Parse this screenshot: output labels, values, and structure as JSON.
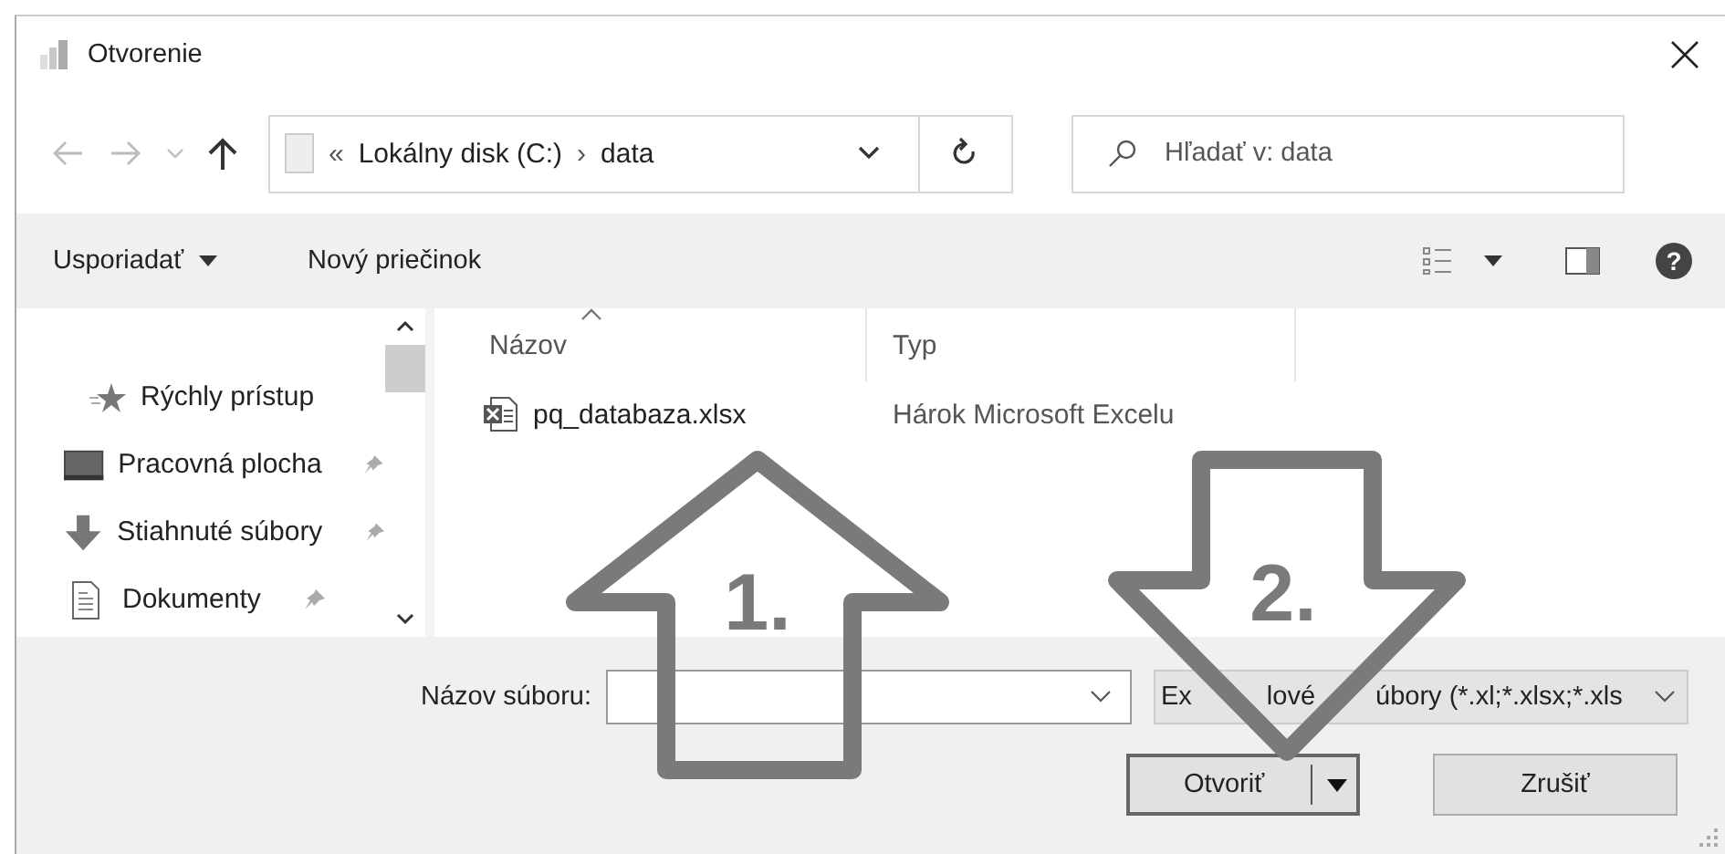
{
  "window": {
    "title": "Otvorenie"
  },
  "nav": {
    "back": {
      "disabled": true
    },
    "forward": {
      "disabled": true
    },
    "up": {
      "disabled": false
    },
    "path": [
      {
        "kind": "overflow",
        "text": "«"
      },
      {
        "kind": "segment",
        "text": "Lokálny disk (C:)"
      },
      {
        "kind": "separator",
        "text": "›"
      },
      {
        "kind": "segment",
        "text": "data"
      }
    ],
    "search": {
      "placeholder": "Hľadať v: data"
    }
  },
  "toolbar": {
    "organize": "Usporiadať",
    "new_folder": "Nový priečinok",
    "help": "?"
  },
  "sidebar": {
    "items": [
      {
        "kind": "quick_access",
        "label": "Rýchly prístup",
        "pinned": false
      },
      {
        "kind": "desktop",
        "label": "Pracovná plocha",
        "pinned": true
      },
      {
        "kind": "downloads",
        "label": "Stiahnuté súbory",
        "pinned": true
      },
      {
        "kind": "documents",
        "label": "Dokumenty",
        "pinned": true
      }
    ]
  },
  "table": {
    "columns": [
      {
        "label": "Názov",
        "sorted": true
      },
      {
        "label": "Typ",
        "sorted": false
      }
    ],
    "rows": [
      {
        "name": "pq_databaza.xlsx",
        "type": "Hárok Microsoft Excelu"
      }
    ]
  },
  "footer": {
    "filename_label": "Názov súboru:",
    "filter": [
      "Ex",
      "lové",
      "úbory (*.xl;*.xlsx;*.xls"
    ],
    "buttons": [
      {
        "kind": "split",
        "label": "Otvoriť"
      },
      {
        "kind": "plain",
        "label": "Zrušiť"
      }
    ]
  },
  "annotations": [
    {
      "kind": "up",
      "label": "1."
    },
    {
      "kind": "down",
      "label": "2."
    }
  ]
}
